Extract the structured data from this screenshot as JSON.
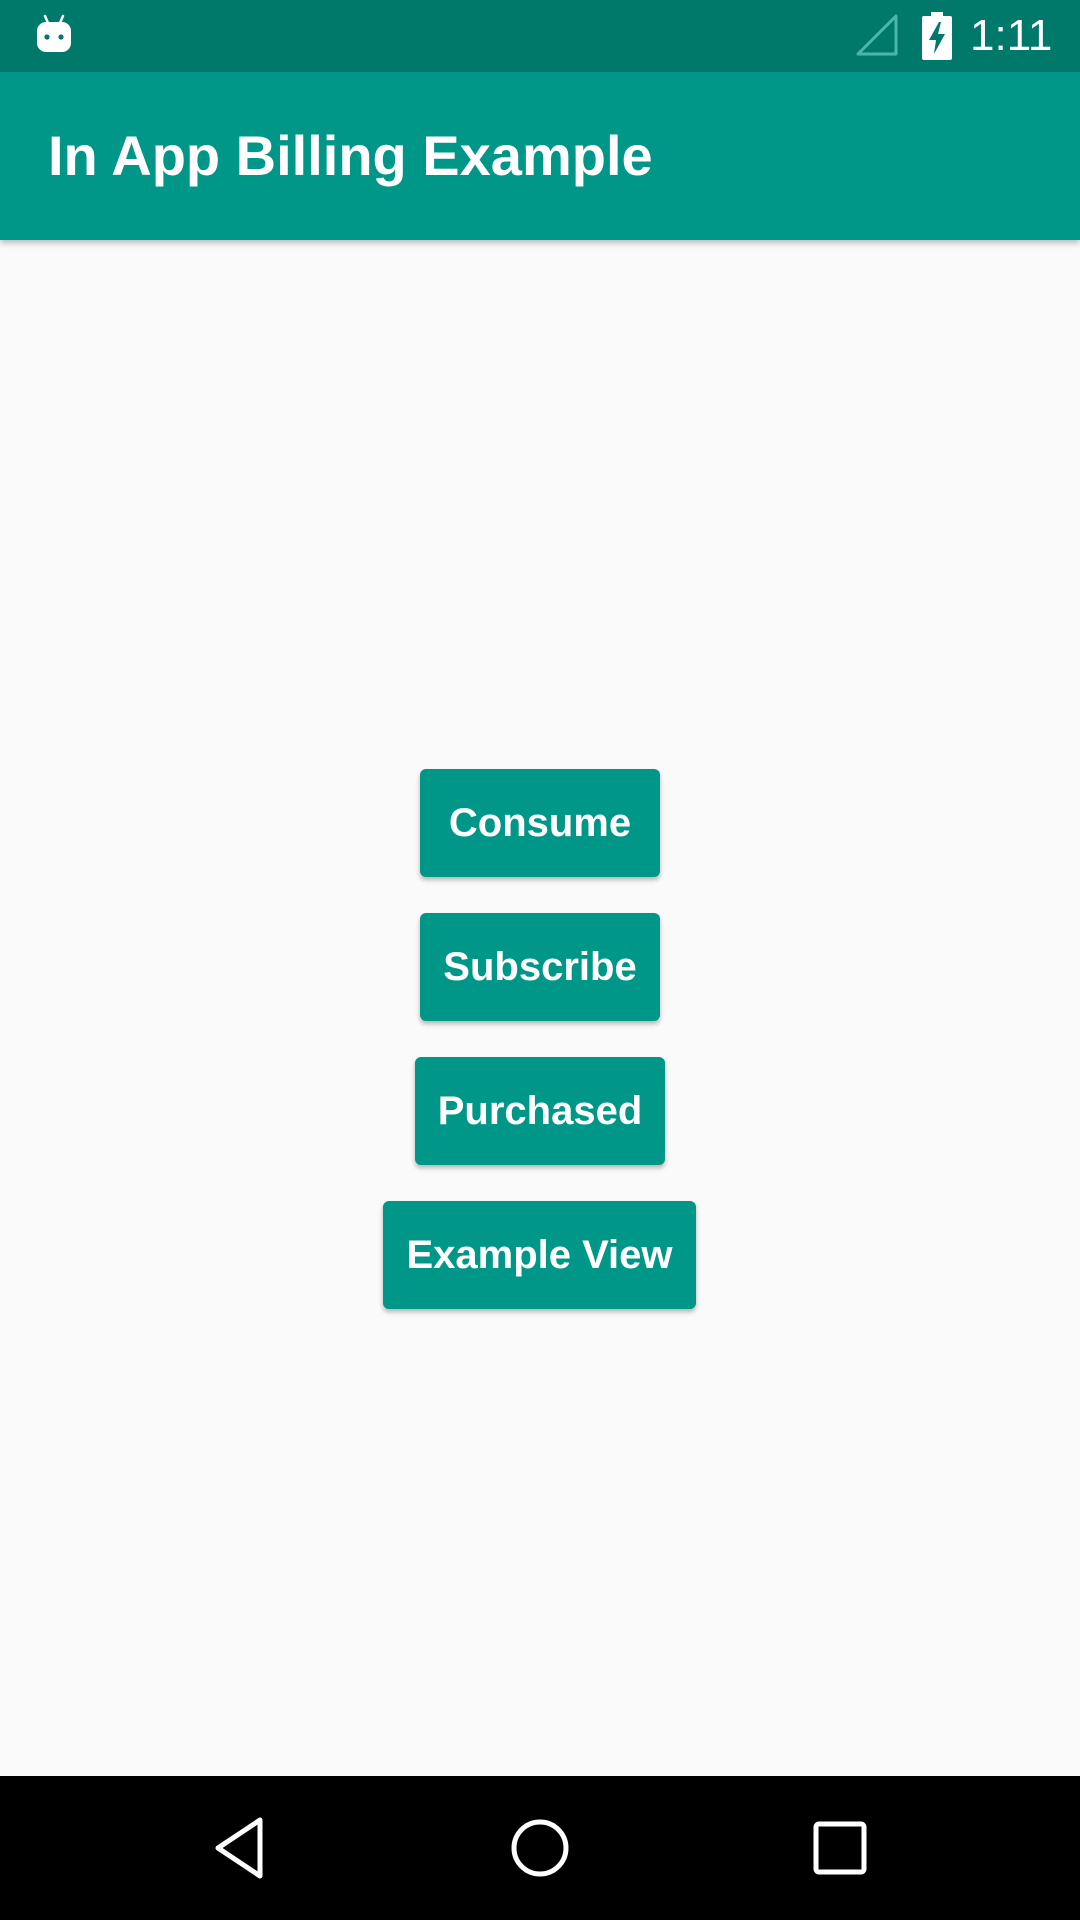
{
  "status_bar": {
    "time": "1:11",
    "notification_icon": "android-robot-icon",
    "signal_icon": "signal-empty-icon",
    "battery_icon": "battery-charging-icon"
  },
  "toolbar": {
    "title": "In App Billing Example"
  },
  "buttons": [
    {
      "label": "Consume"
    },
    {
      "label": "Subscribe"
    },
    {
      "label": "Purchased"
    },
    {
      "label": "Example View"
    }
  ],
  "nav_bar": {
    "back_icon": "back-triangle-icon",
    "home_icon": "home-circle-icon",
    "recents_icon": "recents-square-icon"
  },
  "colors": {
    "primary": "#009688",
    "primary_dark": "#00796b",
    "background": "#fafafa",
    "nav_bar": "#000000",
    "button_text": "#ffffff"
  }
}
